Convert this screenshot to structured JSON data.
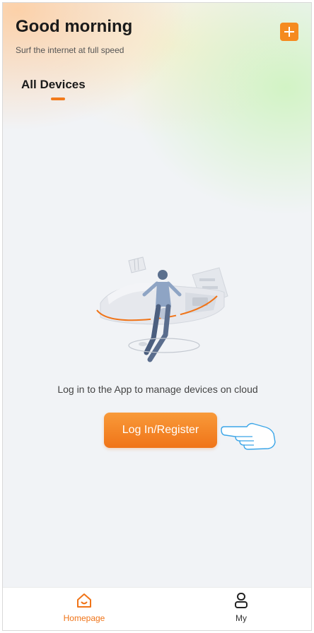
{
  "header": {
    "greeting": "Good morning",
    "subtitle": "Surf the internet at full speed",
    "add_icon": "plus-icon"
  },
  "tabs": [
    {
      "label": "All Devices",
      "active": true
    }
  ],
  "main": {
    "empty_message": "Log in to the App to manage devices on cloud",
    "login_button_label": "Log In/Register",
    "illustration": "person-with-devices-illustration",
    "pointer_icon": "pointing-hand-icon"
  },
  "tabbar": {
    "items": [
      {
        "label": "Homepage",
        "icon": "home-icon",
        "active": true
      },
      {
        "label": "My",
        "icon": "user-icon",
        "active": false
      }
    ]
  },
  "colors": {
    "accent": "#f07418",
    "background": "#f1f3f6",
    "pointer_outline": "#3aa5e8"
  }
}
